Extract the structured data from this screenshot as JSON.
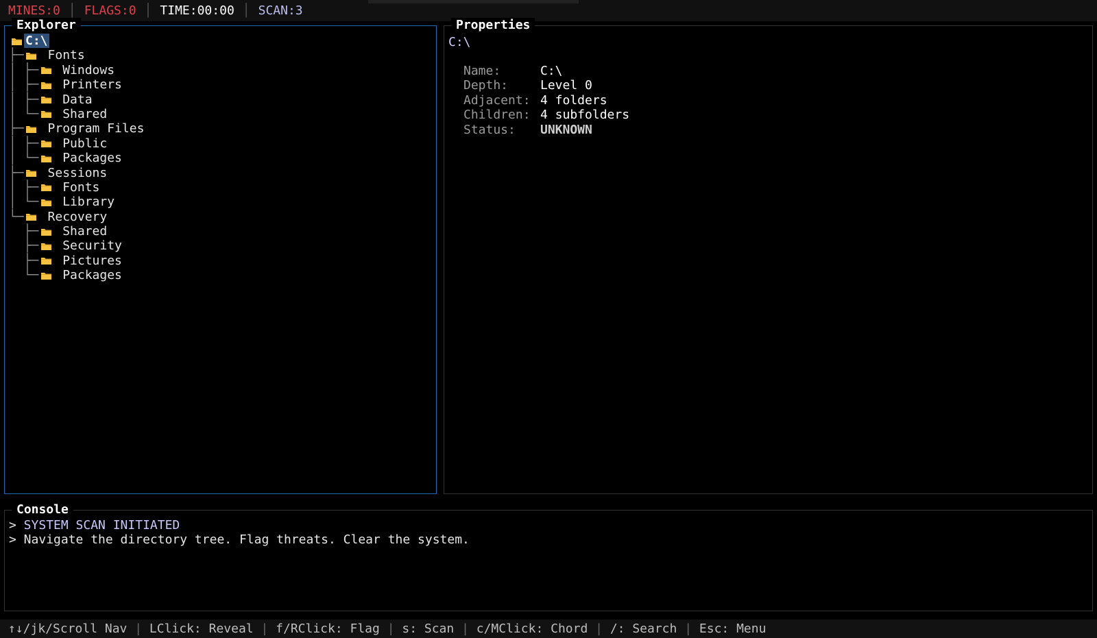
{
  "status": {
    "mines": "MINES:0",
    "flags": "FLAGS:0",
    "time": "TIME:00:00",
    "scan": "SCAN:3",
    "colors": {
      "mines": "#e0404a",
      "flags": "#e0404a",
      "time": "#ffffff",
      "scan": "#bcbcf0"
    }
  },
  "explorer": {
    "title": "Explorer",
    "tree": [
      {
        "label": "C:\\",
        "guide": "",
        "selected": true
      },
      {
        "label": "Fonts",
        "guide": "├─"
      },
      {
        "label": "Windows",
        "guide": "│ ├─"
      },
      {
        "label": "Printers",
        "guide": "│ ├─"
      },
      {
        "label": "Data",
        "guide": "│ ├─"
      },
      {
        "label": "Shared",
        "guide": "│ └─"
      },
      {
        "label": "Program Files",
        "guide": "├─"
      },
      {
        "label": "Public",
        "guide": "│ ├─"
      },
      {
        "label": "Packages",
        "guide": "│ └─"
      },
      {
        "label": "Sessions",
        "guide": "├─"
      },
      {
        "label": "Fonts",
        "guide": "│ ├─"
      },
      {
        "label": "Library",
        "guide": "│ └─"
      },
      {
        "label": "Recovery",
        "guide": "└─"
      },
      {
        "label": "Shared",
        "guide": "  ├─"
      },
      {
        "label": "Security",
        "guide": "  ├─"
      },
      {
        "label": "Pictures",
        "guide": "  ├─"
      },
      {
        "label": "Packages",
        "guide": "  └─"
      }
    ],
    "folder_icon": "folder-icon",
    "folder_color": "#f5c242"
  },
  "properties": {
    "title": "Properties",
    "path": "C:\\",
    "fields": [
      {
        "key": "Name:",
        "value": "C:\\"
      },
      {
        "key": "Depth:",
        "value": "Level 0"
      },
      {
        "key": "Adjacent:",
        "value": "4 folders"
      },
      {
        "key": "Children:",
        "value": "4 subfolders"
      },
      {
        "key": "Status:",
        "value": "UNKNOWN"
      }
    ]
  },
  "console": {
    "title": "Console",
    "lines": [
      {
        "prompt": ">",
        "text": "SYSTEM SCAN INITIATED"
      },
      {
        "prompt": ">",
        "text": "Navigate the directory tree. Flag threats. Clear the system."
      }
    ]
  },
  "help": [
    "↑↓/jk/Scroll Nav",
    "LClick: Reveal",
    "f/RClick: Flag",
    "s: Scan",
    "c/MClick: Chord",
    "/: Search",
    "Esc: Menu"
  ]
}
